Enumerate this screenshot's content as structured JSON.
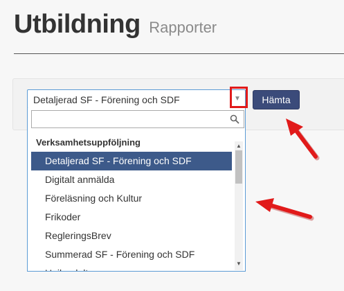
{
  "header": {
    "title": "Utbildning",
    "subtitle": "Rapporter"
  },
  "report_select": {
    "selected_value": "Detaljerad SF - Förening och SDF",
    "arrow_icon": "caret-down-icon"
  },
  "fetch_button": {
    "label": "Hämta"
  },
  "dropdown": {
    "search": {
      "value": "",
      "placeholder": "",
      "icon": "search-icon"
    },
    "group_label": "Verksamhetsuppföljning",
    "options": [
      {
        "label": "Detaljerad SF - Förening och SDF",
        "selected": true
      },
      {
        "label": "Digitalt anmälda",
        "selected": false
      },
      {
        "label": "Föreläsning och Kultur",
        "selected": false
      },
      {
        "label": "Frikoder",
        "selected": false
      },
      {
        "label": "RegleringsBrev",
        "selected": false
      },
      {
        "label": "Summerad SF - Förening och SDF",
        "selected": false
      },
      {
        "label": "Unika deltagare",
        "selected": false
      }
    ]
  },
  "colors": {
    "selected_option_bg": "#3d5a8a",
    "button_bg": "#3b4b7a",
    "annotation_red": "#e11a1a",
    "focus_border": "#5b9bd5"
  }
}
